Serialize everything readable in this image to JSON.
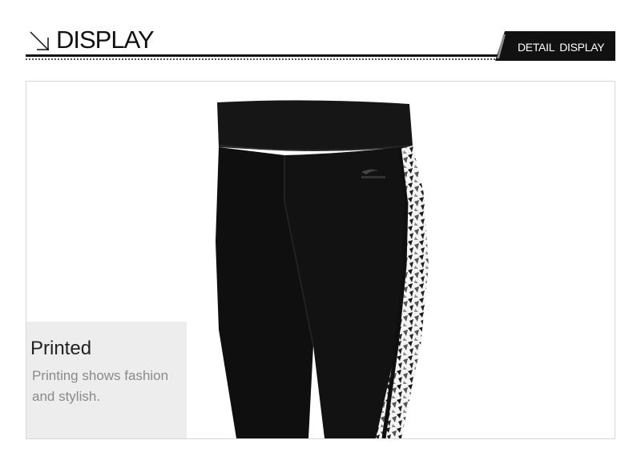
{
  "header": {
    "title": "DISPLAY",
    "tab_label": "DETAIL  DISPLAY",
    "arrow_icon": "diagonal-arrow-icon"
  },
  "product": {
    "image_desc_icon": "leggings-photo",
    "logo_icon": "brand-logo-icon",
    "colors": {
      "fabric": "#0f0f0f",
      "band": "#161616",
      "accent": "#ffffff"
    }
  },
  "feature": {
    "title": "Printed",
    "description_line1": "Printing shows fashion",
    "description_line2": "and stylish."
  }
}
